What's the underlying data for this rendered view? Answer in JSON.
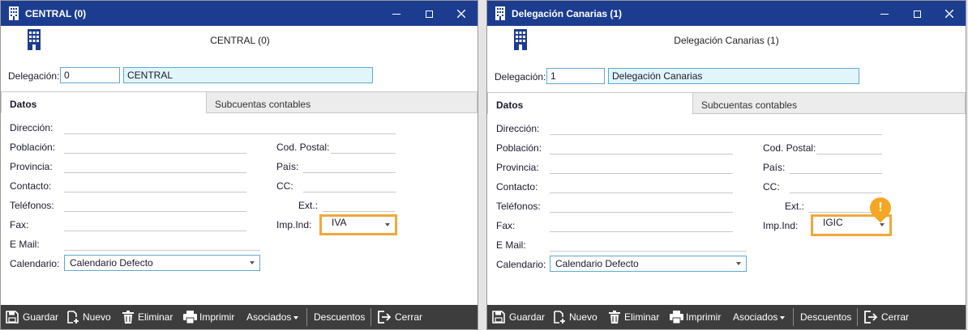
{
  "windows": [
    {
      "title": "CENTRAL (0)",
      "header_title": "CENTRAL (0)",
      "delegacion_label": "Delegación:",
      "delegacion_code": "0",
      "delegacion_name": "CENTRAL",
      "tabs": [
        "Datos",
        "Subcuentas contables"
      ],
      "fields": {
        "direccion": "Dirección:",
        "poblacion": "Población:",
        "provincia": "Provincia:",
        "contacto": "Contacto:",
        "telefonos": "Teléfonos:",
        "fax": "Fax:",
        "email": "E Mail:",
        "calendario": "Calendario:",
        "cod_postal": "Cod. Postal:",
        "pais": "País:",
        "cc": "CC:",
        "ext": "Ext.:",
        "imp_ind": "Imp.Ind:"
      },
      "imp_ind_value": "IVA",
      "calendario_value": "Calendario Defecto",
      "toolbar": [
        "Guardar",
        "Nuevo",
        "Eliminar",
        "Imprimir",
        "Asociados",
        "Descuentos",
        "Cerrar"
      ]
    },
    {
      "title": "Delegación Canarias (1)",
      "header_title": "Delegación Canarias (1)",
      "delegacion_label": "Delegación:",
      "delegacion_code": "1",
      "delegacion_name": "Delegación Canarias",
      "tabs": [
        "Datos",
        "Subcuentas contables"
      ],
      "fields": {
        "direccion": "Dirección:",
        "poblacion": "Población:",
        "provincia": "Provincia:",
        "contacto": "Contacto:",
        "telefonos": "Teléfonos:",
        "fax": "Fax:",
        "email": "E Mail:",
        "calendario": "Calendario:",
        "cod_postal": "Cod. Postal:",
        "pais": "País:",
        "cc": "CC:",
        "ext": "Ext.:",
        "imp_ind": "Imp.Ind:"
      },
      "imp_ind_value": "IGIC",
      "calendario_value": "Calendario Defecto",
      "alert_mark": "!",
      "toolbar": [
        "Guardar",
        "Nuevo",
        "Eliminar",
        "Imprimir",
        "Asociados",
        "Descuentos",
        "Cerrar"
      ]
    }
  ],
  "colors": {
    "titlebar": "#1c3d8f",
    "toolbar": "#3d3d3d",
    "field_border": "#5fa8d0",
    "highlight": "#f0a83a",
    "alert": "#f5a623"
  },
  "icons": {
    "titlebar": "building-icon",
    "save": "save-icon",
    "new": "new-document-icon",
    "delete": "trash-icon",
    "print": "printer-icon",
    "close": "exit-icon"
  }
}
